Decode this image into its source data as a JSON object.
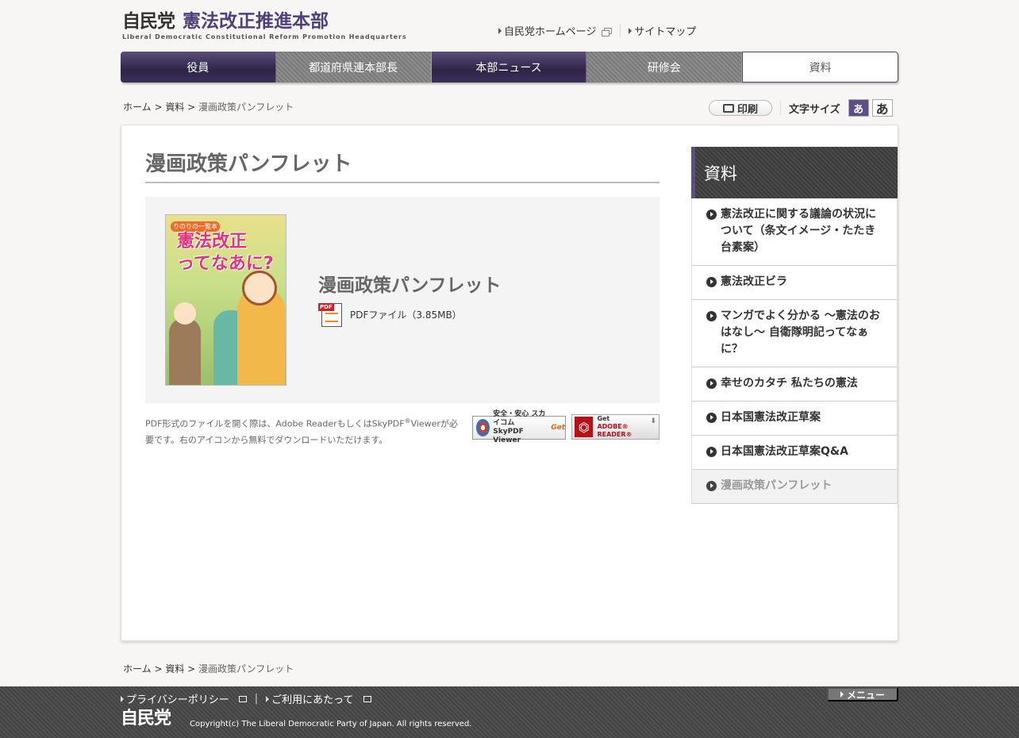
{
  "header": {
    "logo_party": "自民党",
    "logo_title": "憲法改正推進本部",
    "logo_en": "Liberal Democratic Constitutional Reform Promotion Headquarters",
    "links": [
      {
        "label": "自民党ホームページ",
        "external": true
      },
      {
        "label": "サイトマップ",
        "external": false
      }
    ]
  },
  "gnav": {
    "items": [
      {
        "label": "役員",
        "style": "purple"
      },
      {
        "label": "都道府県連本部長",
        "style": "gray"
      },
      {
        "label": "本部ニュース",
        "style": "purple"
      },
      {
        "label": "研修会",
        "style": "gray"
      },
      {
        "label": "資料",
        "style": "current"
      }
    ]
  },
  "breadcrumb": {
    "home": "ホーム",
    "sep": " > ",
    "section": "資料",
    "current": "漫画政策パンフレット"
  },
  "tools": {
    "print_label": "印刷",
    "font_size_label": "文字サイズ",
    "font_small": "あ",
    "font_large": "あ"
  },
  "main": {
    "page_title": "漫画政策パンフレット",
    "cover": {
      "badge": "りのりの一覧本",
      "title_line1": "憲法改正",
      "title_line2": "ってなあに?"
    },
    "doc_title": "漫画政策パンフレット",
    "pdf_link": "PDFファイル（3.85MB）",
    "pdf_tag": "PDF",
    "note_part1": "PDF形式のファイルを開く際は、Adobe ReaderもしくはSkyPDF",
    "note_sup": "®",
    "note_part2": "Viewerが必要です。右のアイコンから無料でダウンロードいただけます。",
    "skypdf": {
      "line1": "安全・安心 スカイコム",
      "get": "Get",
      "line2": "SkyPDF Viewer"
    },
    "adobe": {
      "line1": "Get",
      "line2": "ADOBE® READER®"
    }
  },
  "side": {
    "heading": "資料",
    "items": [
      {
        "label": "憲法改正に関する議論の状況について（条文イメージ・たたき台素案）",
        "current": false
      },
      {
        "label": "憲法改正ビラ",
        "current": false
      },
      {
        "label": "マンガでよく分かる ～憲法のおはなし～ 自衛隊明記ってなぁに？",
        "current": false
      },
      {
        "label": "幸せのカタチ 私たちの憲法",
        "current": false
      },
      {
        "label": "日本国憲法改正草案",
        "current": false
      },
      {
        "label": "日本国憲法改正草案Q&A",
        "current": false
      },
      {
        "label": "漫画政策パンフレット",
        "current": true
      }
    ]
  },
  "footer": {
    "links": [
      "プライバシーポリシー",
      "ご利用にあたって"
    ],
    "sep": "|",
    "menu_label": "メニュー",
    "logo": "自民党",
    "copyright": "Copyright(c) The Liberal Democratic Party of Japan. All rights reserved."
  }
}
